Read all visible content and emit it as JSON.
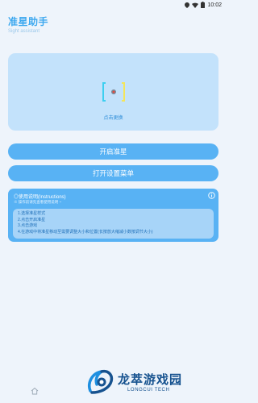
{
  "status_bar": {
    "time": "10:02",
    "icons": [
      "location-icon",
      "wifi-icon",
      "battery-icon"
    ]
  },
  "header": {
    "title": "准星助手",
    "subtitle": "Sight assistant"
  },
  "preview": {
    "label": "点击更换",
    "crosshair_icon": "crosshair-icon"
  },
  "buttons": {
    "start": "开启准星",
    "open_menu": "打开设置菜单"
  },
  "instructions": {
    "title": "◎使用说明(Instructions)",
    "subtitle": "※ 操作前请先查看使用说明 ~",
    "items": [
      "1.选择准星样式",
      "2.点击开启准星",
      "3.点击游戏",
      "4.在游戏中将准星移动至需要调整大小和位置(长按放大缩减小数按调节大小)"
    ],
    "info_icon": "info-icon"
  },
  "watermark": {
    "title": "龙萃游戏园",
    "subtitle": "LONGCUI TECH"
  },
  "nav": {
    "home_icon": "home-icon"
  },
  "colors": {
    "accent": "#58b2f4",
    "title": "#3da8ef",
    "card_bg": "#c3e2fb",
    "page_bg": "#eef4fb",
    "watermark": "#16528f"
  }
}
